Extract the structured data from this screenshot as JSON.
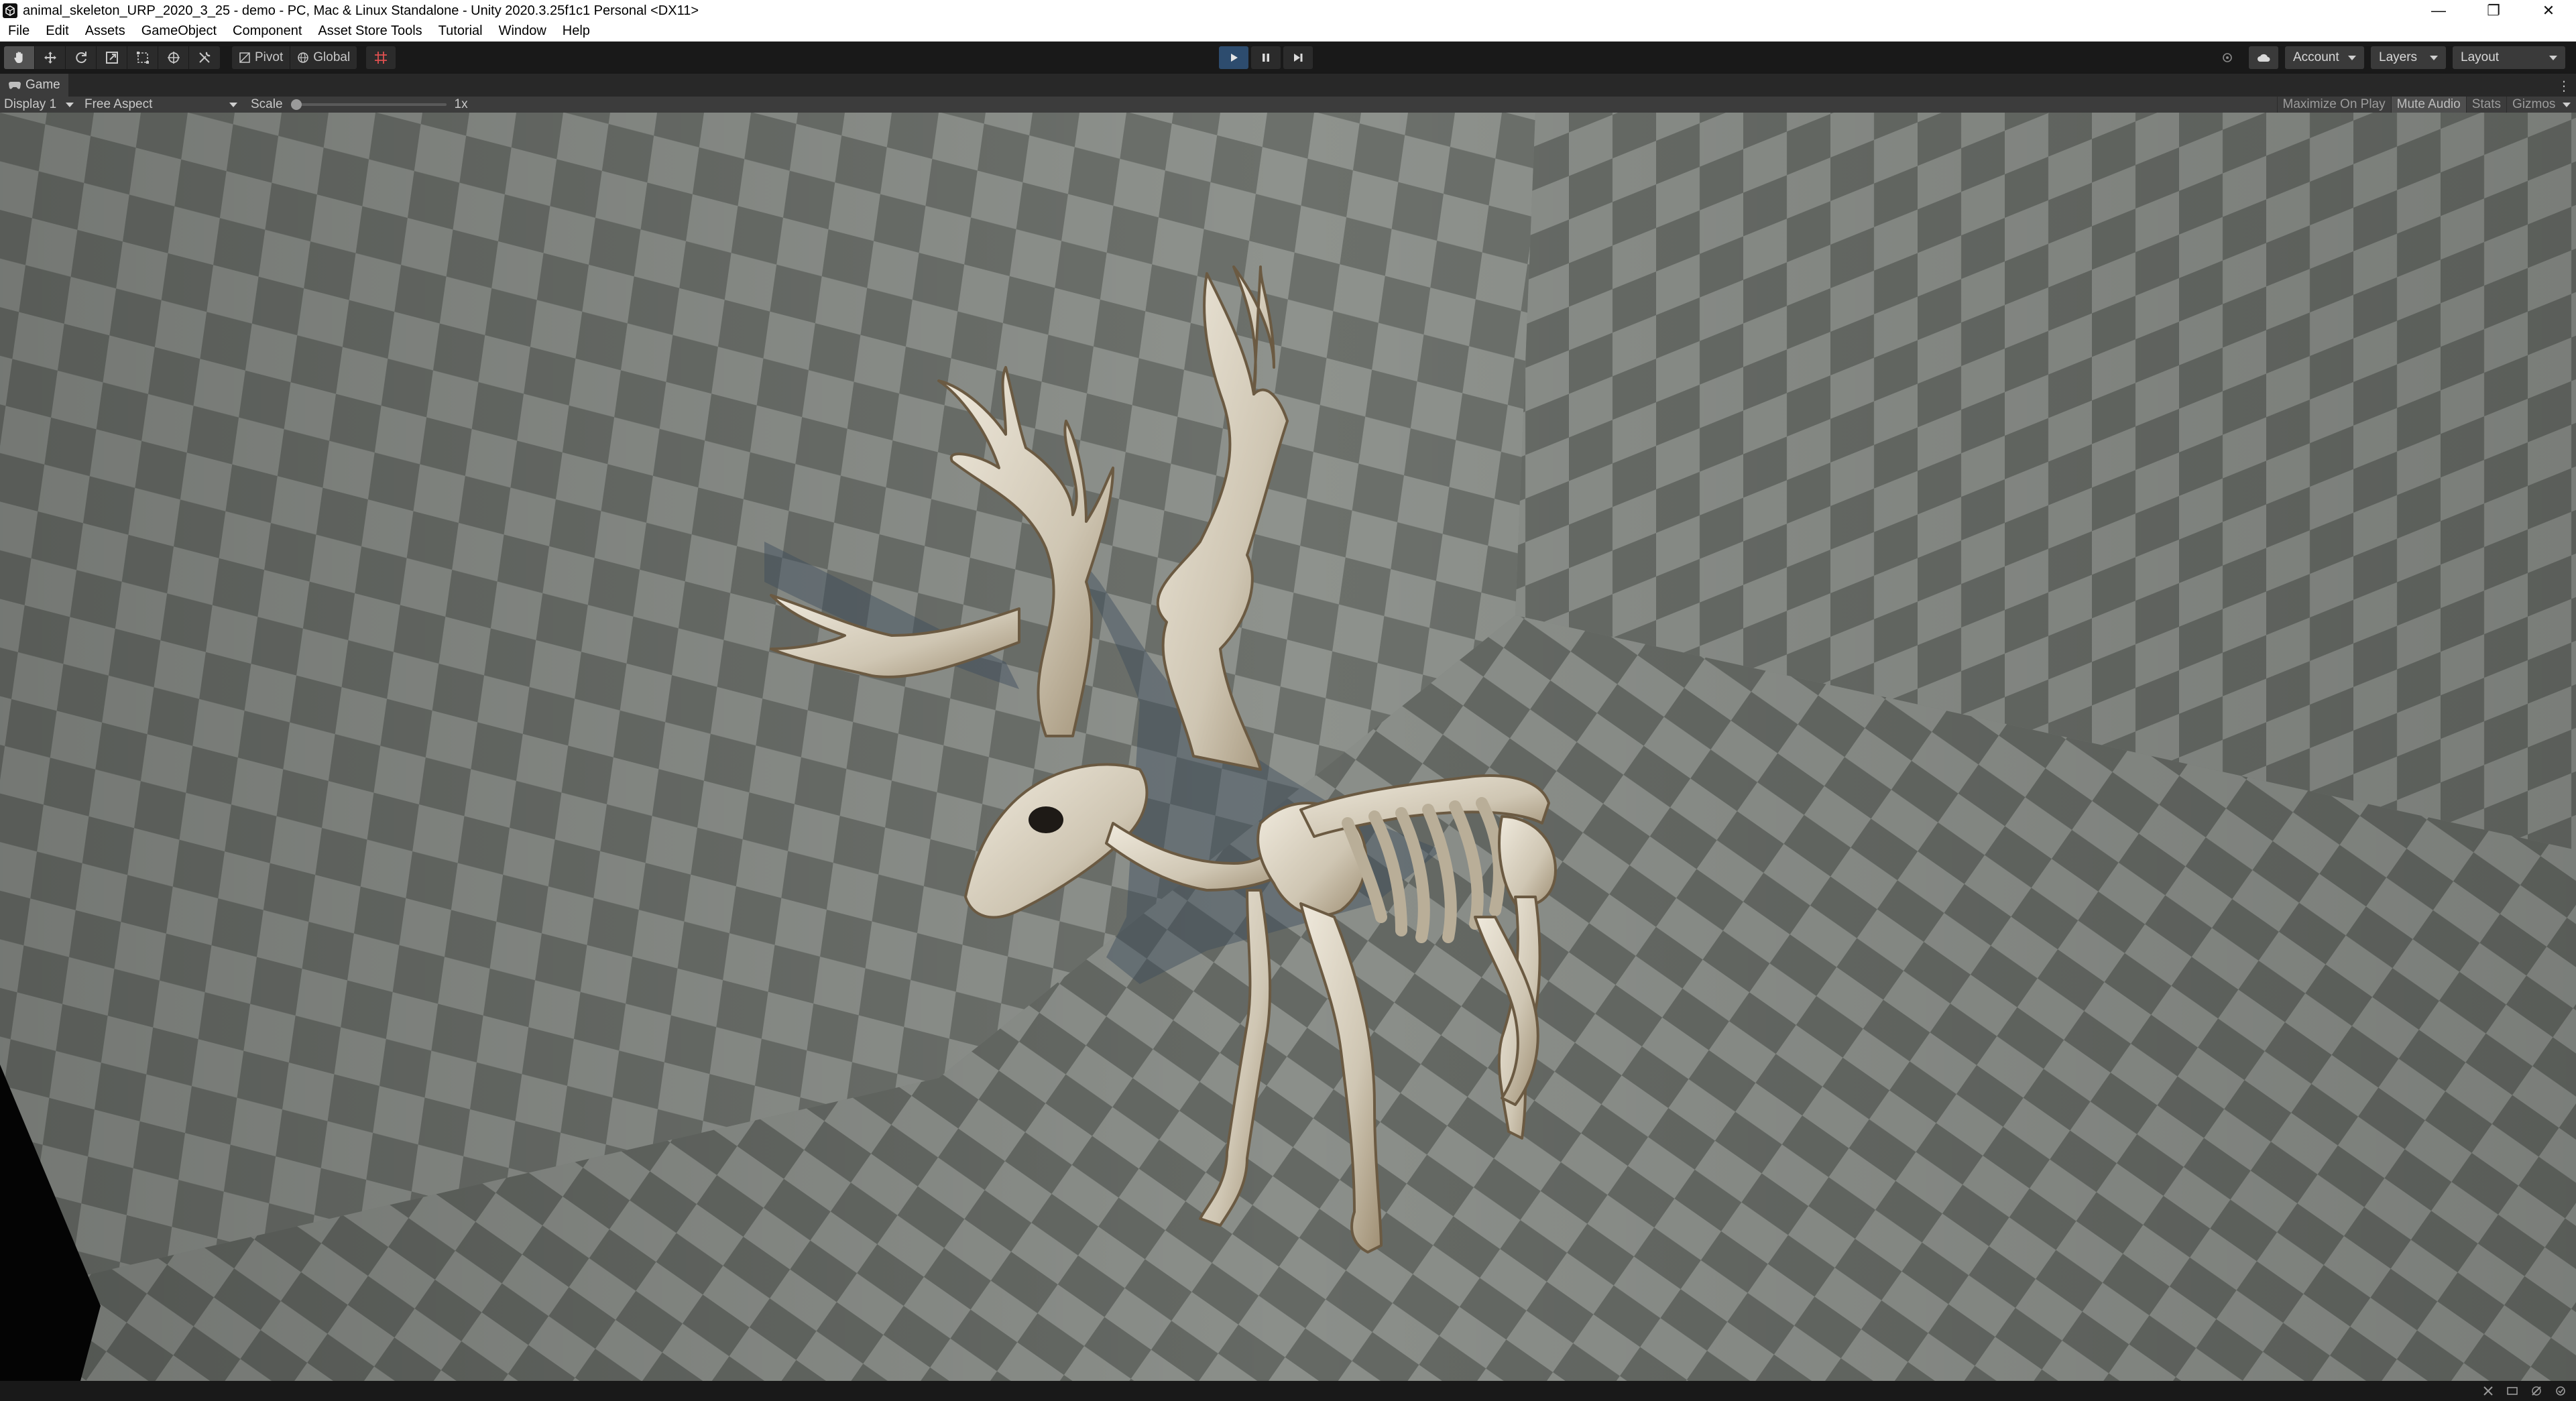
{
  "window": {
    "title": "animal_skeleton_URP_2020_3_25 - demo - PC, Mac & Linux Standalone - Unity 2020.3.25f1c1 Personal <DX11>",
    "controls": [
      "minimize-icon",
      "restore-icon",
      "close-icon"
    ]
  },
  "menu": {
    "items": [
      "File",
      "Edit",
      "Assets",
      "GameObject",
      "Component",
      "Asset Store Tools",
      "Tutorial",
      "Window",
      "Help"
    ]
  },
  "toolbar": {
    "tools": [
      "hand-tool-icon",
      "move-tool-icon",
      "rotate-tool-icon",
      "scale-tool-icon",
      "rect-tool-icon",
      "transform-tool-icon",
      "custom-tool-icon"
    ],
    "pivot_label": "Pivot",
    "global_label": "Global",
    "account_label": "Account",
    "layers_label": "Layers",
    "layout_label": "Layout",
    "play_state": "playing"
  },
  "game_tab": {
    "label": "Game"
  },
  "game_view": {
    "display": "Display 1",
    "aspect": "Free Aspect",
    "scale_label": "Scale",
    "scale_value": "1x",
    "maximize_on_play": "Maximize On Play",
    "mute_audio": "Mute Audio",
    "stats": "Stats",
    "gizmos": "Gizmos"
  },
  "colors": {
    "editor_bg": "#191919",
    "play_active": "#2d4c6e",
    "checker_light": "#8d918c",
    "checker_dark": "#6a6e69",
    "bone": "#d8d0c0"
  }
}
